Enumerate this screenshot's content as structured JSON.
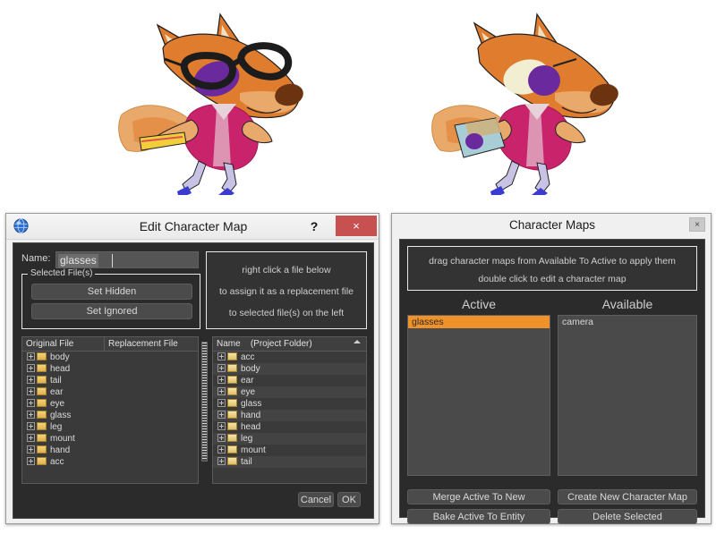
{
  "artwork": {
    "left_character": {
      "name": "fox-character-with-glasses",
      "description": "cartoon fox wearing dark glasses, orange fur, magenta jacket",
      "colors": {
        "fur": "#e07c2e",
        "fur_light": "#e8a96a",
        "jacket": "#c9236b",
        "eye": "#6a2a9e",
        "glasses": "#1c1c1c",
        "nose": "#6b3310",
        "shoe": "#3b3bd0"
      }
    },
    "right_character": {
      "name": "fox-character-without-glasses",
      "description": "same cartoon fox with glasses replaced, showing character map applied",
      "colors": {
        "fur": "#e07c2e",
        "fur_light": "#e8a96a",
        "jacket": "#c9236b",
        "eye": "#6a2a9e",
        "eye_white": "#f2eed2",
        "nose": "#6b3310",
        "shoe": "#3b3bd0"
      }
    }
  },
  "edit_dialog": {
    "title": "Edit Character Map",
    "titlebar_icon": "globe-icon",
    "help_label": "?",
    "close_label": "×",
    "name_label": "Name:",
    "name_value": "glasses",
    "selected_files_legend": "Selected File(s)",
    "set_hidden_label": "Set Hidden",
    "set_ignored_label": "Set Ignored",
    "hint_lines": [
      "right click a file below",
      "to assign it as a replacement file",
      "to selected file(s) on the left"
    ],
    "original_list": {
      "header_original": "Original File",
      "header_replacement": "Replacement File",
      "rows": [
        "body",
        "head",
        "tail",
        "ear",
        "eye",
        "glass",
        "leg",
        "mount",
        "hand",
        "acc"
      ]
    },
    "project_list": {
      "header_name": "Name",
      "header_folder": "(Project Folder)",
      "sort_icon": "caret-up-icon",
      "rows": [
        "acc",
        "body",
        "ear",
        "eye",
        "glass",
        "hand",
        "head",
        "leg",
        "mount",
        "tail"
      ]
    },
    "cancel_label": "Cancel",
    "ok_label": "OK"
  },
  "maps_panel": {
    "title": "Character Maps",
    "close_label": "×",
    "hint_lines": [
      "drag character maps from Available To Active to apply them",
      "double click to edit a character map"
    ],
    "active_header": "Active",
    "available_header": "Available",
    "active_items": [
      "glasses"
    ],
    "available_items": [
      "camera"
    ],
    "selected_active": "glasses",
    "buttons": {
      "merge": "Merge Active To New",
      "create": "Create New Character Map",
      "bake": "Bake Active To Entity",
      "delete": "Delete Selected"
    },
    "colors": {
      "selection": "#f0922b",
      "panel_bg": "#2b2b2b",
      "list_bg": "#4a4a4a"
    }
  }
}
